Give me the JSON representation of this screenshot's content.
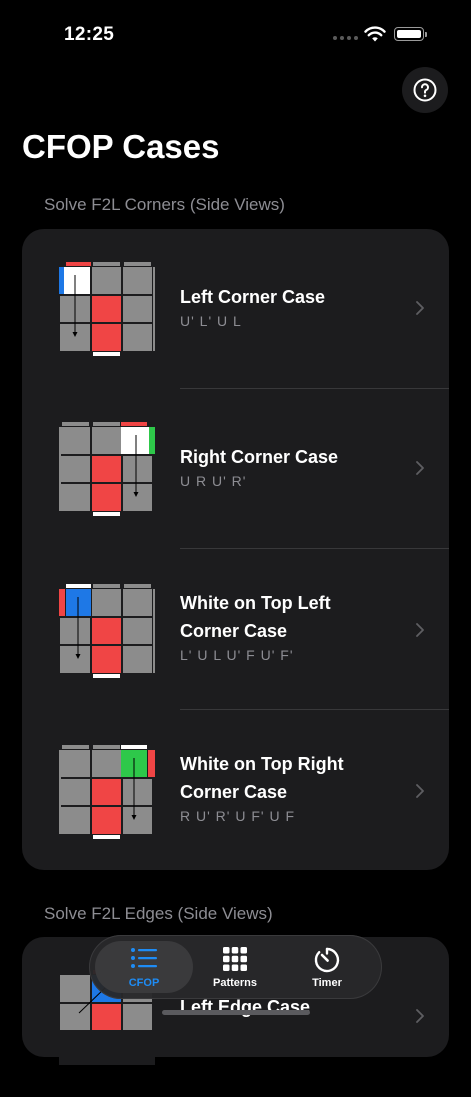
{
  "status_bar": {
    "time": "12:25"
  },
  "header": {
    "title": "CFOP Cases",
    "help_icon": "question-circle-icon"
  },
  "sections": [
    {
      "header": "Solve F2L Corners (Side Views)",
      "items": [
        {
          "title": "Left Corner Case",
          "algorithm": "U' L' U L"
        },
        {
          "title": "Right Corner Case",
          "algorithm": "U R U' R'"
        },
        {
          "title": "White on Top Left Corner Case",
          "algorithm": "L' U L U' F U' F'"
        },
        {
          "title": "White on Top Right Corner Case",
          "algorithm": "R U' R' U F' U F"
        }
      ]
    },
    {
      "header": "Solve F2L Edges (Side Views)",
      "items": [
        {
          "title": "Left Edge Case",
          "algorithm": ""
        }
      ]
    }
  ],
  "tab_bar": {
    "tabs": [
      {
        "label": "CFOP",
        "icon": "list-icon",
        "selected": true
      },
      {
        "label": "Patterns",
        "icon": "grid-icon",
        "selected": false
      },
      {
        "label": "Timer",
        "icon": "timer-icon",
        "selected": false
      }
    ]
  },
  "colors": {
    "accent": "#1e8cf5",
    "sticker_gray": "#8c8c8c",
    "sticker_red": "#f04545",
    "sticker_white": "#ffffff",
    "sticker_blue": "#1e78e6",
    "sticker_green": "#2ec84a",
    "card": "#1c1c1e"
  }
}
